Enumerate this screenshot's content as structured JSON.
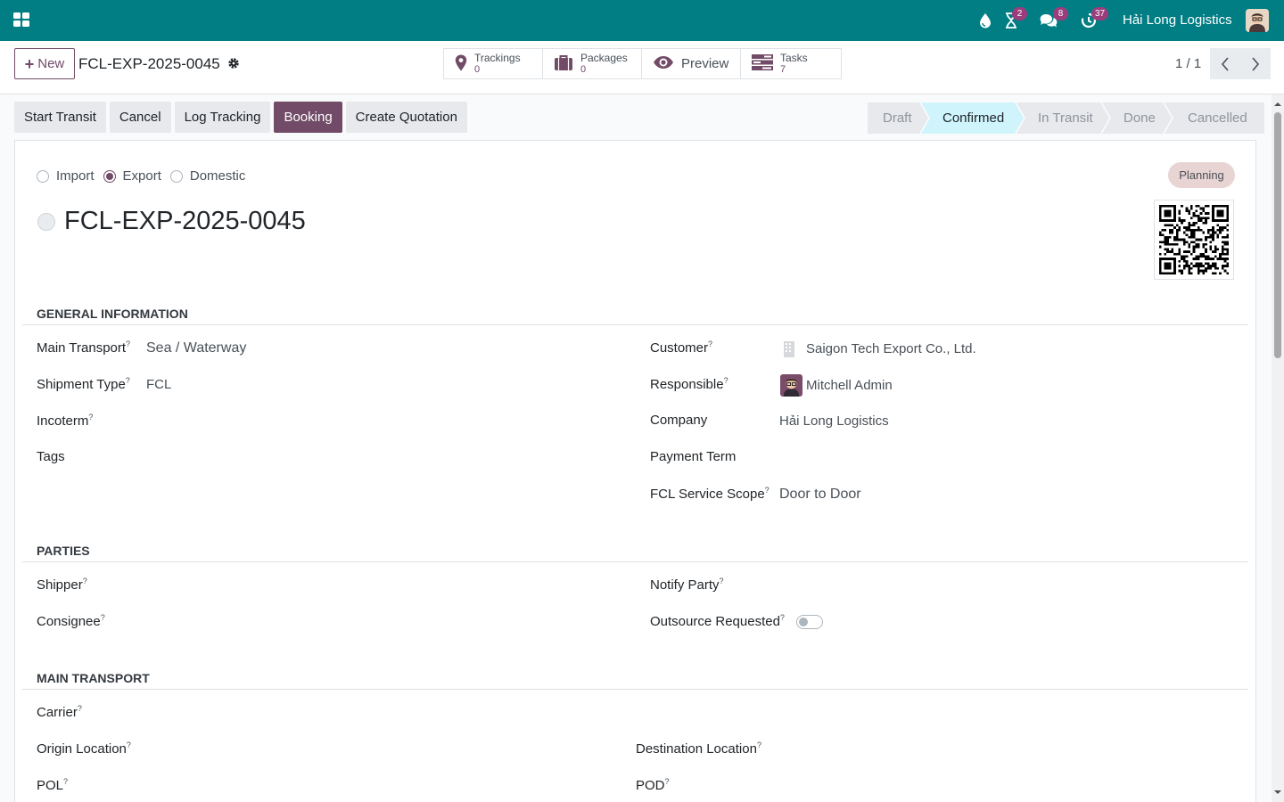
{
  "navbar": {
    "company": "Hải Long Logistics",
    "activity_count": "2",
    "messages_count": "8",
    "timer_count": "37"
  },
  "control": {
    "new_label": "New",
    "record_name": "FCL-EXP-2025-0045",
    "pager": "1 / 1",
    "smart_buttons": {
      "trackings": {
        "label": "Trackings",
        "value": "0"
      },
      "packages": {
        "label": "Packages",
        "value": "0"
      },
      "preview": {
        "label": "Preview"
      },
      "tasks": {
        "label": "Tasks",
        "value": "7"
      }
    }
  },
  "actions": {
    "start_transit": "Start Transit",
    "cancel": "Cancel",
    "log_tracking": "Log Tracking",
    "booking": "Booking",
    "create_quotation": "Create Quotation"
  },
  "status": {
    "stages": [
      "Draft",
      "Confirmed",
      "In Transit",
      "Done",
      "Cancelled"
    ],
    "active": "Confirmed"
  },
  "form": {
    "direction": {
      "import": "Import",
      "export": "Export",
      "domestic": "Domestic",
      "selected": "Export"
    },
    "tag": "Planning",
    "title": "FCL-EXP-2025-0045",
    "general": {
      "heading": "GENERAL INFORMATION",
      "main_transport_label": "Main Transport",
      "main_transport_value": "Sea / Waterway",
      "shipment_type_label": "Shipment Type",
      "shipment_type_value": "FCL",
      "incoterm_label": "Incoterm",
      "tags_label": "Tags",
      "customer_label": "Customer",
      "customer_value": "Saigon Tech Export Co., Ltd.",
      "responsible_label": "Responsible",
      "responsible_value": "Mitchell Admin",
      "company_label": "Company",
      "company_value": "Hải Long Logistics",
      "payment_term_label": "Payment Term",
      "fcl_scope_label": "FCL Service Scope",
      "fcl_scope_value": "Door to Door"
    },
    "parties": {
      "heading": "PARTIES",
      "shipper_label": "Shipper",
      "consignee_label": "Consignee",
      "notify_label": "Notify Party",
      "outsource_label": "Outsource Requested"
    },
    "main_transport": {
      "heading": "MAIN TRANSPORT",
      "carrier_label": "Carrier",
      "origin_label": "Origin Location",
      "destination_label": "Destination Location",
      "pol_label": "POL",
      "pod_label": "POD"
    }
  },
  "colors": {
    "navbar": "#017e84",
    "primary": "#714b67",
    "active_stage": "#cff4fc"
  },
  "icons": [
    "apps-icon",
    "drop-icon",
    "hourglass-icon",
    "chat-icon",
    "timer-icon",
    "gear-icon",
    "map-pin-icon",
    "briefcase-icon",
    "eye-icon",
    "tasks-icon",
    "chevron-left-icon",
    "chevron-right-icon",
    "building-icon",
    "qr-code-icon"
  ]
}
